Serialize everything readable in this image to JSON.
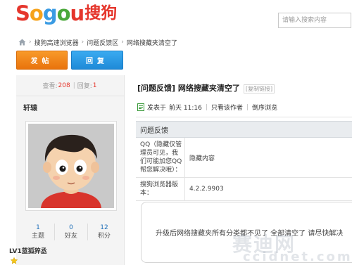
{
  "logo": {
    "letters": [
      {
        "ch": "S",
        "color": "#e5362c"
      },
      {
        "ch": "o",
        "color": "#f6a21b"
      },
      {
        "ch": "g",
        "color": "#3a9be3"
      },
      {
        "ch": "o",
        "color": "#4aa83a"
      },
      {
        "ch": "u",
        "color": "#e5362c"
      }
    ],
    "cn": "搜狗"
  },
  "search": {
    "placeholder": "请输入搜索内容"
  },
  "breadcrumb": {
    "items": [
      "搜狗高速浏览器",
      "问题反馈区",
      "网络搜藏夹清空了"
    ],
    "separator": "›"
  },
  "actions": {
    "post": "发帖",
    "reply": "回复"
  },
  "post_stats": {
    "views_label": "查看:",
    "views": "208",
    "divider": "|",
    "replies_label": "回复:",
    "replies": "1"
  },
  "user": {
    "name": "轩辕",
    "stats": [
      {
        "n": "1",
        "label": "主题"
      },
      {
        "n": "0",
        "label": "好友"
      },
      {
        "n": "12",
        "label": "积分"
      }
    ],
    "level": "LV1蓝狐猝丞"
  },
  "thread": {
    "title": "[问题反馈] 网络搜藏夹清空了",
    "copy_link": "[复制链接]",
    "posted_prefix": "发表于",
    "posted_time": "前天 11:16",
    "only_author": "只看该作者",
    "reverse": "倒序浏览"
  },
  "feedback": {
    "header": "问题反馈",
    "rows": [
      {
        "key": "QQ（隐藏仅管理员可见，我们可能加您QQ帮您解决哦）：",
        "value": "隐藏内容"
      },
      {
        "key": "搜狗浏览器版本：",
        "value": "4.2.2.9903"
      }
    ]
  },
  "post_body": {
    "text": "升级后网络搜藏夹所有分类都不见了 全部清空了 请尽快解决"
  },
  "watermark": {
    "line1": "赛迪网",
    "line2": "ccidnet.com"
  },
  "colors": {
    "brand_red": "#e5362c",
    "orange": "#f08a1c",
    "blue": "#2a98e4",
    "link_blue": "#1f6fb8"
  }
}
